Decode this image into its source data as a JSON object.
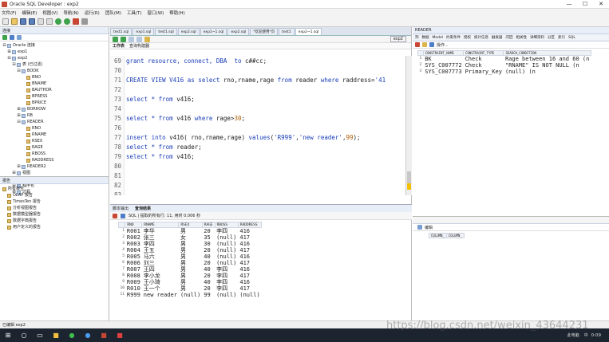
{
  "window": {
    "title": "Oracle SQL Developer : exp2",
    "min": "—",
    "max": "☐",
    "close": "✕"
  },
  "menu": [
    "文件(F)",
    "编辑(E)",
    "视图(V)",
    "导航(N)",
    "运行(R)",
    "团队(M)",
    "工具(T)",
    "窗口(W)",
    "帮助(H)"
  ],
  "left_panel": {
    "title": "连接",
    "tree": [
      {
        "label": "Oracle 连接",
        "indent": 0,
        "exp": "⊟"
      },
      {
        "label": "exp1",
        "indent": 1,
        "exp": "⊞"
      },
      {
        "label": "exp2",
        "indent": 1,
        "exp": "⊟"
      },
      {
        "label": "表 (已过滤)",
        "indent": 2,
        "exp": "⊟"
      },
      {
        "label": "BOOK",
        "indent": 3,
        "exp": "⊟"
      },
      {
        "label": "BNO",
        "indent": 4,
        "exp": ""
      },
      {
        "label": "BNAME",
        "indent": 4,
        "exp": ""
      },
      {
        "label": "BAUTHOR",
        "indent": 4,
        "exp": ""
      },
      {
        "label": "BPRESS",
        "indent": 4,
        "exp": ""
      },
      {
        "label": "BPRICE",
        "indent": 4,
        "exp": ""
      },
      {
        "label": "BORROW",
        "indent": 3,
        "exp": "⊞"
      },
      {
        "label": "RB",
        "indent": 3,
        "exp": "⊞"
      },
      {
        "label": "READER",
        "indent": 3,
        "exp": "⊟"
      },
      {
        "label": "RNO",
        "indent": 4,
        "exp": ""
      },
      {
        "label": "RNAME",
        "indent": 4,
        "exp": ""
      },
      {
        "label": "RSEX",
        "indent": 4,
        "exp": ""
      },
      {
        "label": "RAGE",
        "indent": 4,
        "exp": ""
      },
      {
        "label": "RBOSS",
        "indent": 4,
        "exp": ""
      },
      {
        "label": "RADDRESS",
        "indent": 4,
        "exp": ""
      },
      {
        "label": "READER2",
        "indent": 3,
        "exp": "⊞"
      },
      {
        "label": "视图",
        "indent": 2,
        "exp": "⊞"
      },
      {
        "label": "索引",
        "indent": 2,
        "exp": "⊞"
      },
      {
        "label": "程序包",
        "indent": 2,
        "exp": "⊞"
      },
      {
        "label": "过程",
        "indent": 2,
        "exp": "⊞"
      }
    ],
    "reports_title": "报告",
    "reports": [
      "所有报告",
      "OLAP 报告",
      "TimesTen 报告",
      "分析视图报告",
      "数据模型器报告",
      "数据字典报告",
      "用户定义的报告"
    ]
  },
  "editor": {
    "tabs": [
      "test1.sql",
      "exp1.sql",
      "test1.sql",
      "exp2.sql",
      "exp1~1.sql",
      "exp2.sql",
      "*欢迎使用*页",
      "test1",
      "exp2~1.sql"
    ],
    "active_tab": 8,
    "connection": "exp2",
    "sub_tabs": [
      "工作表",
      "查询构建器"
    ],
    "lines": [
      {
        "n": "69",
        "tokens": [
          [
            "kw",
            "grant resource, connect, DBA  to "
          ],
          [
            "txt",
            "c##cc;"
          ]
        ]
      },
      {
        "n": "70",
        "tokens": []
      },
      {
        "n": "71",
        "tokens": [
          [
            "kw",
            "CREATE VIEW V416 as select "
          ],
          [
            "txt",
            "rno,rname,rage "
          ],
          [
            "kw",
            "from "
          ],
          [
            "txt",
            "reader "
          ],
          [
            "kw",
            "where "
          ],
          [
            "txt",
            "raddress="
          ],
          [
            "str",
            "'41"
          ]
        ]
      },
      {
        "n": "72",
        "tokens": []
      },
      {
        "n": "73",
        "tokens": [
          [
            "kw",
            "select * from "
          ],
          [
            "txt",
            "v416;"
          ]
        ]
      },
      {
        "n": "74",
        "tokens": []
      },
      {
        "n": "75",
        "tokens": [
          [
            "kw",
            "select * from "
          ],
          [
            "txt",
            "v416 "
          ],
          [
            "kw",
            "where "
          ],
          [
            "txt",
            "rage>"
          ],
          [
            "num",
            "30"
          ],
          [
            "txt",
            ";"
          ]
        ]
      },
      {
        "n": "76",
        "tokens": []
      },
      {
        "n": "77",
        "tokens": [
          [
            "kw",
            "insert into "
          ],
          [
            "txt",
            "v416( rno,rname,rage) "
          ],
          [
            "kw",
            "values"
          ],
          [
            "txt",
            "("
          ],
          [
            "str",
            "'R999'"
          ],
          [
            "txt",
            ","
          ],
          [
            "str",
            "'new reader'"
          ],
          [
            "txt",
            ","
          ],
          [
            "num",
            "99"
          ],
          [
            "txt",
            ");"
          ]
        ]
      },
      {
        "n": "78",
        "tokens": [
          [
            "kw",
            "select * from "
          ],
          [
            "txt",
            "reader;"
          ]
        ]
      },
      {
        "n": "79",
        "tokens": [
          [
            "kw",
            "select * from "
          ],
          [
            "txt",
            "v416;"
          ]
        ]
      },
      {
        "n": "80",
        "tokens": []
      },
      {
        "n": "81",
        "tokens": []
      },
      {
        "n": "82",
        "tokens": []
      },
      {
        "n": "83",
        "tokens": []
      }
    ]
  },
  "results": {
    "tabs": [
      "脚本输出",
      "查询结果"
    ],
    "toolbar_text": "SQL | 提取的所有行: 11, 用时 0.006 秒",
    "columns": [
      "RNO",
      "RNAME",
      "RSEX",
      "RAGE",
      "RBOSS",
      "RADDRESS"
    ],
    "rows": [
      [
        "1",
        "R001",
        "李华",
        "男",
        "20",
        "李四",
        "416"
      ],
      [
        "2",
        "R002",
        "张三",
        "女",
        "35",
        "(null)",
        "417"
      ],
      [
        "3",
        "R003",
        "李四",
        "男",
        "30",
        "(null)",
        "416"
      ],
      [
        "4",
        "R004",
        "王五",
        "男",
        "20",
        "(null)",
        "417"
      ],
      [
        "5",
        "R005",
        "马六",
        "男",
        "40",
        "(null)",
        "416"
      ],
      [
        "6",
        "R006",
        "刘三",
        "男",
        "20",
        "(null)",
        "417"
      ],
      [
        "7",
        "R007",
        "王四",
        "男",
        "40",
        "李四",
        "416"
      ],
      [
        "8",
        "R008",
        "李小龙",
        "男",
        "20",
        "李四",
        "417"
      ],
      [
        "9",
        "R009",
        "王小琦",
        "男",
        "40",
        "李四",
        "416"
      ],
      [
        "10",
        "R010",
        "王一个",
        "男",
        "20",
        "李四",
        "417"
      ],
      [
        "11",
        "R999",
        "new reader",
        "(null)",
        "99",
        "(null)",
        "(null)"
      ]
    ]
  },
  "right_panel": {
    "title": "READER",
    "tabs": [
      "列",
      "数据",
      "Model",
      "约束条件",
      "授权",
      "统计信息",
      "触发器",
      "闪回",
      "相关性",
      "详细资料",
      "分区",
      "索引",
      "SQL"
    ],
    "action": "操作...",
    "columns": [
      "CONSTRAINT_NAME",
      "CONSTRAINT_TYPE",
      "SEARCH_CONDITION"
    ],
    "rows": [
      [
        "1",
        "BK",
        "Check",
        "Rage between 16 and 60 (n"
      ],
      [
        "2",
        "SYS_C007772",
        "Check",
        "\"RNAME\" IS NOT NULL   (n"
      ],
      [
        "3",
        "SYS_C007773",
        "Primary_Key",
        "(null)             (n"
      ]
    ],
    "lower_title": "编辑",
    "lower_columns": [
      "COLUMN_",
      "COLUMN_"
    ]
  },
  "status": {
    "text": "已编辑  exp2"
  },
  "watermark": "https://blog.csdn.net/weixin_43644231",
  "taskbar": {
    "time": "0:09",
    "lang": "中",
    "tray": "此电脑"
  }
}
